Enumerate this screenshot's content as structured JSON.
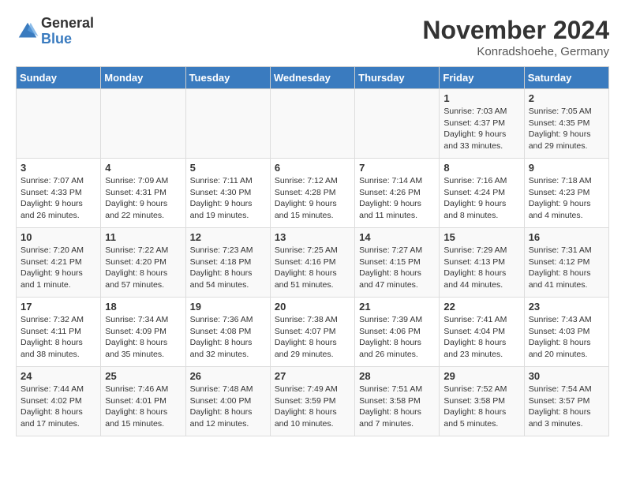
{
  "header": {
    "logo": {
      "general": "General",
      "blue": "Blue"
    },
    "title": "November 2024",
    "location": "Konradshoehe, Germany"
  },
  "weekdays": [
    "Sunday",
    "Monday",
    "Tuesday",
    "Wednesday",
    "Thursday",
    "Friday",
    "Saturday"
  ],
  "weeks": [
    [
      {
        "day": "",
        "info": ""
      },
      {
        "day": "",
        "info": ""
      },
      {
        "day": "",
        "info": ""
      },
      {
        "day": "",
        "info": ""
      },
      {
        "day": "",
        "info": ""
      },
      {
        "day": "1",
        "info": "Sunrise: 7:03 AM\nSunset: 4:37 PM\nDaylight: 9 hours\nand 33 minutes."
      },
      {
        "day": "2",
        "info": "Sunrise: 7:05 AM\nSunset: 4:35 PM\nDaylight: 9 hours\nand 29 minutes."
      }
    ],
    [
      {
        "day": "3",
        "info": "Sunrise: 7:07 AM\nSunset: 4:33 PM\nDaylight: 9 hours\nand 26 minutes."
      },
      {
        "day": "4",
        "info": "Sunrise: 7:09 AM\nSunset: 4:31 PM\nDaylight: 9 hours\nand 22 minutes."
      },
      {
        "day": "5",
        "info": "Sunrise: 7:11 AM\nSunset: 4:30 PM\nDaylight: 9 hours\nand 19 minutes."
      },
      {
        "day": "6",
        "info": "Sunrise: 7:12 AM\nSunset: 4:28 PM\nDaylight: 9 hours\nand 15 minutes."
      },
      {
        "day": "7",
        "info": "Sunrise: 7:14 AM\nSunset: 4:26 PM\nDaylight: 9 hours\nand 11 minutes."
      },
      {
        "day": "8",
        "info": "Sunrise: 7:16 AM\nSunset: 4:24 PM\nDaylight: 9 hours\nand 8 minutes."
      },
      {
        "day": "9",
        "info": "Sunrise: 7:18 AM\nSunset: 4:23 PM\nDaylight: 9 hours\nand 4 minutes."
      }
    ],
    [
      {
        "day": "10",
        "info": "Sunrise: 7:20 AM\nSunset: 4:21 PM\nDaylight: 9 hours\nand 1 minute."
      },
      {
        "day": "11",
        "info": "Sunrise: 7:22 AM\nSunset: 4:20 PM\nDaylight: 8 hours\nand 57 minutes."
      },
      {
        "day": "12",
        "info": "Sunrise: 7:23 AM\nSunset: 4:18 PM\nDaylight: 8 hours\nand 54 minutes."
      },
      {
        "day": "13",
        "info": "Sunrise: 7:25 AM\nSunset: 4:16 PM\nDaylight: 8 hours\nand 51 minutes."
      },
      {
        "day": "14",
        "info": "Sunrise: 7:27 AM\nSunset: 4:15 PM\nDaylight: 8 hours\nand 47 minutes."
      },
      {
        "day": "15",
        "info": "Sunrise: 7:29 AM\nSunset: 4:13 PM\nDaylight: 8 hours\nand 44 minutes."
      },
      {
        "day": "16",
        "info": "Sunrise: 7:31 AM\nSunset: 4:12 PM\nDaylight: 8 hours\nand 41 minutes."
      }
    ],
    [
      {
        "day": "17",
        "info": "Sunrise: 7:32 AM\nSunset: 4:11 PM\nDaylight: 8 hours\nand 38 minutes."
      },
      {
        "day": "18",
        "info": "Sunrise: 7:34 AM\nSunset: 4:09 PM\nDaylight: 8 hours\nand 35 minutes."
      },
      {
        "day": "19",
        "info": "Sunrise: 7:36 AM\nSunset: 4:08 PM\nDaylight: 8 hours\nand 32 minutes."
      },
      {
        "day": "20",
        "info": "Sunrise: 7:38 AM\nSunset: 4:07 PM\nDaylight: 8 hours\nand 29 minutes."
      },
      {
        "day": "21",
        "info": "Sunrise: 7:39 AM\nSunset: 4:06 PM\nDaylight: 8 hours\nand 26 minutes."
      },
      {
        "day": "22",
        "info": "Sunrise: 7:41 AM\nSunset: 4:04 PM\nDaylight: 8 hours\nand 23 minutes."
      },
      {
        "day": "23",
        "info": "Sunrise: 7:43 AM\nSunset: 4:03 PM\nDaylight: 8 hours\nand 20 minutes."
      }
    ],
    [
      {
        "day": "24",
        "info": "Sunrise: 7:44 AM\nSunset: 4:02 PM\nDaylight: 8 hours\nand 17 minutes."
      },
      {
        "day": "25",
        "info": "Sunrise: 7:46 AM\nSunset: 4:01 PM\nDaylight: 8 hours\nand 15 minutes."
      },
      {
        "day": "26",
        "info": "Sunrise: 7:48 AM\nSunset: 4:00 PM\nDaylight: 8 hours\nand 12 minutes."
      },
      {
        "day": "27",
        "info": "Sunrise: 7:49 AM\nSunset: 3:59 PM\nDaylight: 8 hours\nand 10 minutes."
      },
      {
        "day": "28",
        "info": "Sunrise: 7:51 AM\nSunset: 3:58 PM\nDaylight: 8 hours\nand 7 minutes."
      },
      {
        "day": "29",
        "info": "Sunrise: 7:52 AM\nSunset: 3:58 PM\nDaylight: 8 hours\nand 5 minutes."
      },
      {
        "day": "30",
        "info": "Sunrise: 7:54 AM\nSunset: 3:57 PM\nDaylight: 8 hours\nand 3 minutes."
      }
    ]
  ]
}
